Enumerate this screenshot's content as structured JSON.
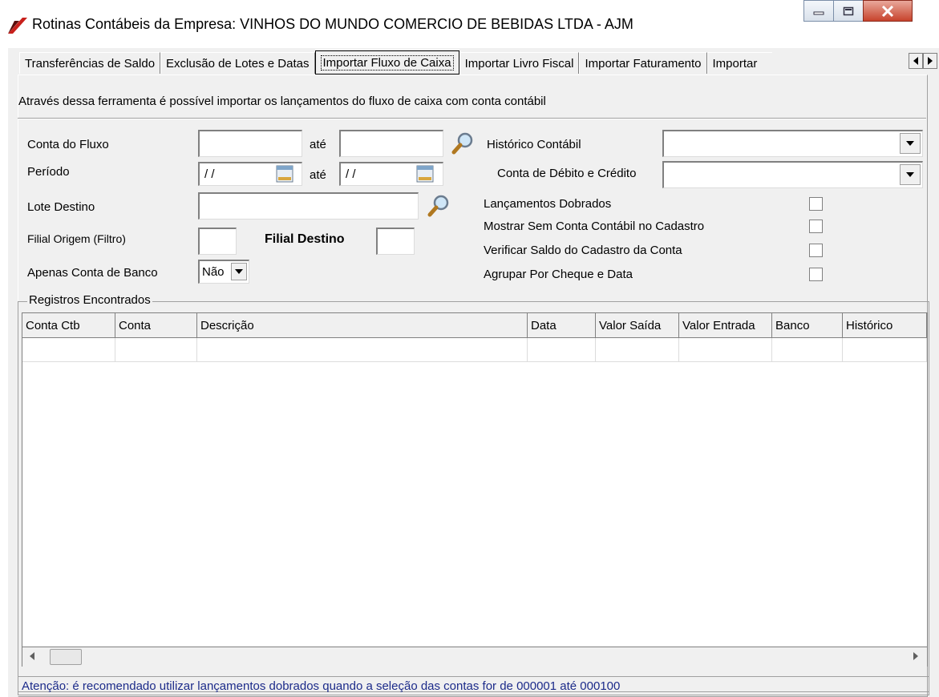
{
  "window": {
    "title": "Rotinas Contábeis da Empresa: VINHOS DO MUNDO COMERCIO DE BEBIDAS LTDA - AJM",
    "logo_icon": "app-logo-icon",
    "controls": [
      "minimize-icon",
      "maximize-icon",
      "close-icon"
    ]
  },
  "tabs": {
    "items": [
      {
        "label": "Transferências de Saldo",
        "active": false
      },
      {
        "label": "Exclusão de Lotes e Datas",
        "active": false
      },
      {
        "label": "Importar Fluxo de Caixa",
        "active": true
      },
      {
        "label": "Importar Livro Fiscal",
        "active": false
      },
      {
        "label": "Importar Faturamento",
        "active": false
      },
      {
        "label": "Importar",
        "active": false
      }
    ],
    "scroll_left_icon": "arrow-left-icon",
    "scroll_right_icon": "arrow-right-icon"
  },
  "description": "Através dessa ferramenta é possível importar os lançamentos do fluxo de caixa com conta contábil",
  "form": {
    "conta_fluxo_label": "Conta do Fluxo",
    "conta_fluxo_de": "",
    "ate_label_1": "até",
    "conta_fluxo_ate": "",
    "periodo_label": "Período",
    "periodo_de": "/ /",
    "ate_label_2": "até",
    "periodo_ate": "/ /",
    "lote_destino_label": "Lote Destino",
    "lote_destino": "",
    "filial_origem_label": "Filial Origem (Filtro)",
    "filial_origem": "",
    "filial_destino_label": "Filial Destino",
    "filial_destino": "",
    "apenas_banco_label": "Apenas Conta de Banco",
    "apenas_banco_value": "Não",
    "historico_label": "Histórico Contábil",
    "historico_value": "",
    "debito_credito_label": "Conta de Débito e Crédito",
    "debito_credito_value": "",
    "checks": [
      {
        "label": "Lançamentos Dobrados",
        "checked": false
      },
      {
        "label": "Mostrar Sem Conta Contábil no Cadastro",
        "checked": false
      },
      {
        "label": "Verificar Saldo do Cadastro da Conta",
        "checked": false
      },
      {
        "label": "Agrupar Por Cheque e Data",
        "checked": false
      }
    ]
  },
  "results": {
    "group_title": "Registros Encontrados",
    "columns": [
      "Conta Ctb",
      "Conta",
      "Descrição",
      "Data",
      "Valor Saída",
      "Valor Entrada",
      "Banco",
      "Histórico"
    ],
    "rows": [
      [
        "",
        "",
        "",
        "",
        "",
        "",
        "",
        ""
      ]
    ]
  },
  "status_text": "Atenção: é recomendado utilizar lançamentos dobrados quando a seleção das contas for de 000001 até 000100"
}
